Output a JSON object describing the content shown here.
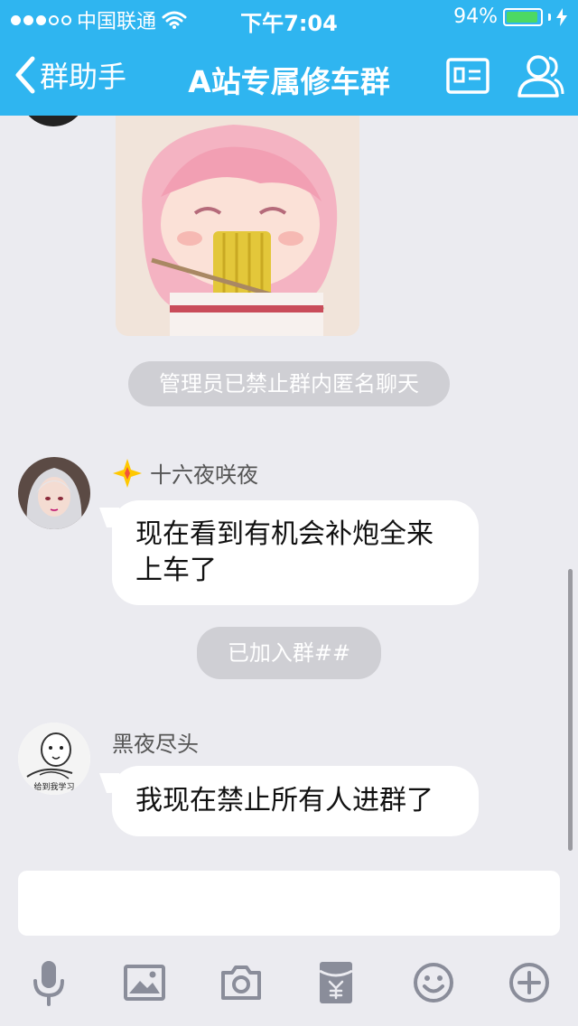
{
  "status_bar": {
    "carrier": "中国联通",
    "time": "下午7:04",
    "battery_percent": "94%",
    "battery_level": 0.94,
    "signal_bars_filled": 3,
    "signal_bars_total": 5
  },
  "nav": {
    "back_label": "群助手",
    "title": "A站专属修车群",
    "icons": [
      "chevron-left-icon",
      "profile-card-icon",
      "group-members-icon"
    ]
  },
  "messages": {
    "system_1": "管理员已禁止群内匿名聊天",
    "msg_1": {
      "sender": "十六夜咲夜",
      "text": "现在看到有机会补炮全来上车了",
      "line1": "现在看到有机会补炮全来",
      "line2": "上车了"
    },
    "system_2": "已加入群##",
    "msg_2": {
      "sender": "黑夜尽头",
      "text": "我现在禁止所有人进群了",
      "avatar_caption": "给到我学习"
    }
  },
  "input": {
    "value": "",
    "placeholder": ""
  },
  "toolbar": {
    "icons": [
      "microphone-icon",
      "image-icon",
      "camera-icon",
      "red-packet-icon",
      "emoji-icon",
      "plus-icon"
    ]
  },
  "colors": {
    "header_blue": "#2fb5f0",
    "chat_background": "#ebebf0",
    "system_pill": "#cfcfd4",
    "toolbar_icon": "#8a8d9a",
    "battery_green": "#4cd964"
  }
}
